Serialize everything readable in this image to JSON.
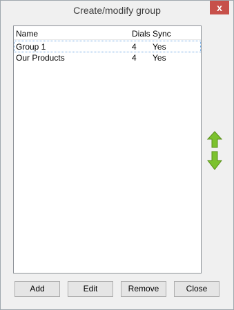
{
  "window": {
    "title": "Create/modify group",
    "close_glyph": "x"
  },
  "list": {
    "columns": [
      "Name",
      "Dials",
      "Sync"
    ],
    "rows": [
      {
        "name": "Group 1",
        "dials": "4",
        "sync": "Yes"
      },
      {
        "name": "Our Products",
        "dials": "4",
        "sync": "Yes"
      }
    ]
  },
  "side_controls": {
    "up_icon": "up-arrow-icon",
    "down_icon": "down-arrow-icon",
    "accent_color": "#7cc22e"
  },
  "buttons": {
    "add": "Add",
    "edit": "Edit",
    "remove": "Remove",
    "close": "Close"
  }
}
